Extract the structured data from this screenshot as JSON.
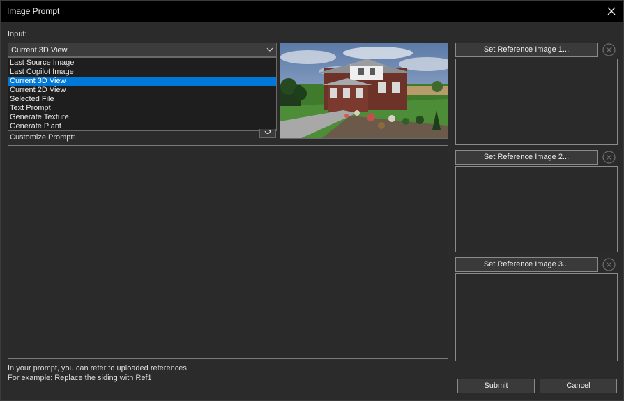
{
  "window": {
    "title": "Image Prompt"
  },
  "input": {
    "label": "Input:",
    "selected": "Current 3D View",
    "options": [
      "Last Source Image",
      "Last Copilot Image",
      "Current 3D View",
      "Current 2D View",
      "Selected File",
      "Text Prompt",
      "Generate Texture",
      "Generate Plant"
    ],
    "highlighted_index": 2
  },
  "customize_prompt": {
    "label": "Customize Prompt:",
    "value": ""
  },
  "references": [
    {
      "button_label": "Set Reference Image 1..."
    },
    {
      "button_label": "Set Reference Image 2..."
    },
    {
      "button_label": "Set Reference Image 3..."
    }
  ],
  "hint": {
    "line1": "In your prompt, you can refer to uploaded references",
    "line2": "For example: Replace the siding with Ref1"
  },
  "actions": {
    "submit_label": "Submit",
    "cancel_label": "Cancel"
  },
  "icons": {
    "close": "close-icon",
    "chevron": "chevron-down-icon",
    "clear": "clear-circle-icon",
    "reset": "undo-icon"
  },
  "colors": {
    "selection": "#0078d7",
    "titlebar": "#000000",
    "background": "#2b2b2b"
  }
}
